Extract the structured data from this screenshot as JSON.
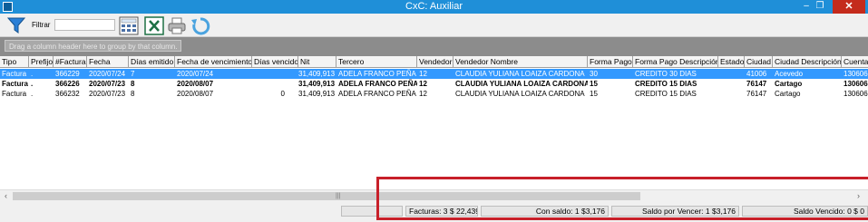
{
  "window": {
    "title": "CxC: Auxiliar"
  },
  "toolbar": {
    "filter_label": "Filtrar",
    "filter_value": ""
  },
  "grid": {
    "group_hint": "Drag a column header here to group by that column.",
    "columns": [
      "Tipo",
      "Prefijo",
      "#Factura",
      "Fecha",
      "Días emitido",
      "Fecha de vencimiento",
      "Días vencido",
      "Nit",
      "Tercero",
      "Vendedor",
      "Vendedor Nombre",
      "Forma Pago",
      "Forma Pago Descripción",
      "Estado",
      "Ciudad",
      "Ciudad Descripción",
      "Cuenta"
    ],
    "rows": [
      [
        "Factura",
        ".",
        "366229",
        "2020/07/24",
        "7",
        "2020/07/24",
        "",
        "31,409,913",
        "ADELA FRANCO PEÑA",
        "12",
        "CLAUDIA YULIANA LOAIZA CARDONA",
        "30",
        "CREDITO 30 DIAS",
        "",
        "41006",
        "Acevedo",
        "130606"
      ],
      [
        "Factura",
        ".",
        "366226",
        "2020/07/23",
        "8",
        "2020/08/07",
        "",
        "31,409,913",
        "ADELA FRANCO PEÑA",
        "12",
        "CLAUDIA YULIANA LOAIZA CARDONA",
        "15",
        "CREDITO 15 DIAS",
        "",
        "76147",
        "Cartago",
        "130606"
      ],
      [
        "Factura",
        ".",
        "366232",
        "2020/07/23",
        "8",
        "2020/08/07",
        "0",
        "31,409,913",
        "ADELA FRANCO PEÑA",
        "12",
        "CLAUDIA YULIANA LOAIZA CARDONA",
        "15",
        "CREDITO 15 DIAS",
        "",
        "76147",
        "Cartago",
        "130606"
      ]
    ]
  },
  "summary": {
    "facturas": "Facturas: 3",
    "facturas_total": "$ 22,439",
    "con_saldo": "Con saldo: 1",
    "con_saldo_total": "$3,176",
    "por_vencer": "Saldo por Vencer: 1",
    "por_vencer_total": "$3,176",
    "vencido": "Saldo Vencido: 0 $ 0"
  },
  "colors": {
    "titlebar": "#1f8fd8",
    "selection": "#3399ff",
    "highlight": "#c8202a"
  }
}
